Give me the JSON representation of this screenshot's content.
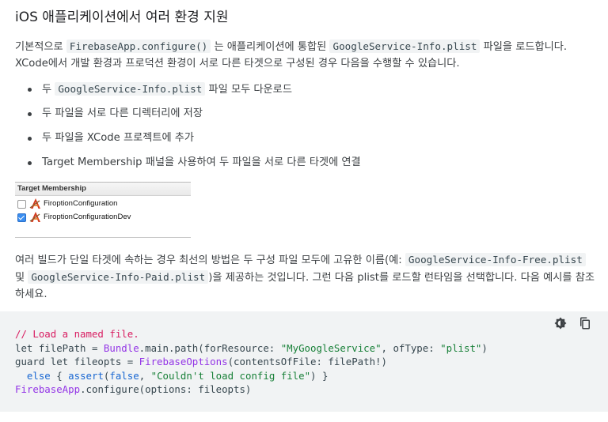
{
  "heading": "iOS 애플리케이션에서 여러 환경 지원",
  "intro": {
    "t1": "기본적으로 ",
    "c1": "FirebaseApp.configure()",
    "t2": " 는 애플리케이션에 통합된 ",
    "c2": "GoogleService-Info.plist",
    "t3": " 파일을 로드합니다. XCode에서 개발 환경과 프로덕션 환경이 서로 다른 타겟으로 구성된 경우 다음을 수행할 수 있습니다."
  },
  "bullets": {
    "b1_pre": "두 ",
    "b1_code": "GoogleService-Info.plist",
    "b1_post": " 파일 모두 다운로드",
    "b2": "두 파일을 서로 다른 디렉터리에 저장",
    "b3": "두 파일을 XCode 프로젝트에 추가",
    "b4": "Target Membership 패널을 사용하여 두 파일을 서로 다른 타겟에 연결"
  },
  "xcode_panel": {
    "header": "Target Membership",
    "rows": [
      {
        "label": "FiroptionConfiguration",
        "checked": false
      },
      {
        "label": "FiroptionConfigurationDev",
        "checked": true
      }
    ]
  },
  "para2": {
    "t1": "여러 빌드가 단일 타겟에 속하는 경우 최선의 방법은 두 구성 파일 모두에 고유한 이름(예: ",
    "c1": "GoogleService-Info-Free.plist",
    "t2": " 및 ",
    "c2": "GoogleService-Info-Paid.plist",
    "t3": ")을 제공하는 것입니다. 그런 다음 plist를 로드할 런타임을 선택합니다. 다음 예시를 참조하세요."
  },
  "code": {
    "l1": "// Load a named file.",
    "l2a": "let filePath = ",
    "l2b": "Bundle",
    "l2c": ".main.path(forResource: ",
    "l2d": "\"MyGoogleService\"",
    "l2e": ", ofType: ",
    "l2f": "\"plist\"",
    "l2g": ")",
    "l3a": "guard let fileopts = ",
    "l3b": "FirebaseOptions",
    "l3c": "(contentsOfFile: filePath!)",
    "l4a": "  ",
    "l4b": "else",
    "l4c": " { ",
    "l4d": "assert",
    "l4e": "(",
    "l4f": "false",
    "l4g": ", ",
    "l4h": "\"Couldn't load config file\"",
    "l4i": ") }",
    "l5a": "FirebaseApp",
    "l5b": ".configure(options: fileopts)"
  },
  "code_tools": [
    "dark-theme-icon",
    "copy-icon"
  ]
}
